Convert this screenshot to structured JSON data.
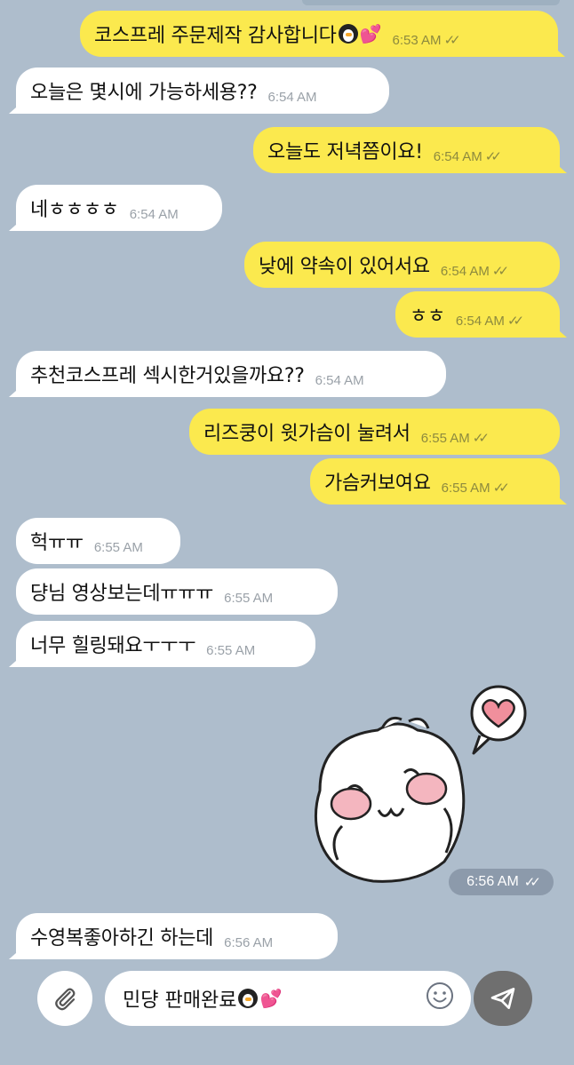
{
  "messages": [
    {
      "dir": "out",
      "text": "코스프레 주문제작 감사합니다",
      "time": "6:53 AM",
      "emojis": [
        "penguin",
        "hearts"
      ]
    },
    {
      "dir": "in",
      "text": "오늘은 몇시에 가능하세용??",
      "time": "6:54 AM"
    },
    {
      "dir": "out",
      "text": "오늘도 저녁쯤이요!",
      "time": "6:54 AM"
    },
    {
      "dir": "in",
      "text": "네ㅎㅎㅎㅎ",
      "time": "6:54 AM"
    },
    {
      "dir": "out",
      "text": "낮에 약속이 있어서요",
      "time": "6:54 AM"
    },
    {
      "dir": "out",
      "text": "ㅎㅎ",
      "time": "6:54 AM"
    },
    {
      "dir": "in",
      "text": "추천코스프레 섹시한거있을까요??",
      "time": "6:54 AM"
    },
    {
      "dir": "out",
      "text": "리즈쿵이 윗가슴이 눌려서",
      "time": "6:55 AM"
    },
    {
      "dir": "out",
      "text": "가슴커보여요",
      "time": "6:55 AM"
    },
    {
      "dir": "in",
      "text": "헉ㅠㅠ",
      "time": "6:55 AM"
    },
    {
      "dir": "in",
      "text": "댱님 영상보는데ㅠㅠㅠ",
      "time": "6:55 AM"
    },
    {
      "dir": "in",
      "text": "너무 힐링돼요ㅜㅜㅜ",
      "time": "6:55 AM"
    },
    {
      "dir": "in",
      "text": "수영복좋아하긴 하는데",
      "time": "6:56 AM"
    }
  ],
  "sticker": {
    "time": "6:56 AM",
    "icon": "bear-with-heart-sticker"
  },
  "composer": {
    "input_value": "민댱 판매완료",
    "input_emojis": [
      "penguin",
      "hearts"
    ]
  },
  "read_ticks": "✓✓",
  "colors": {
    "background": "#aebdcc",
    "incoming": "#ffffff",
    "outgoing": "#fbe94e",
    "send_button": "#6f6f6f"
  }
}
